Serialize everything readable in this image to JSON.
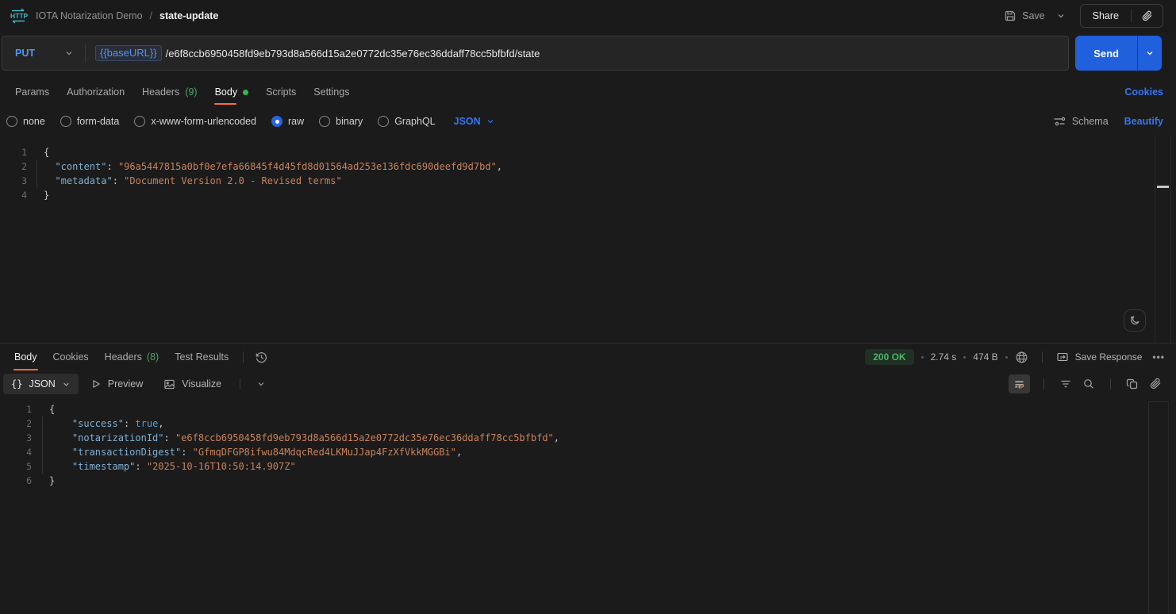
{
  "header": {
    "collection_name": "IOTA Notarization Demo",
    "separator": "/",
    "request_name": "state-update",
    "save_label": "Save",
    "share_label": "Share"
  },
  "request_bar": {
    "method": "PUT",
    "base_url_variable": "{{baseURL}}",
    "path": "/e6f8ccb6950458fd9eb793d8a566d15a2e0772dc35e76ec36ddaff78cc5bfbfd/state",
    "send_label": "Send"
  },
  "request_tabs": {
    "items": [
      {
        "label": "Params"
      },
      {
        "label": "Authorization"
      },
      {
        "label": "Headers",
        "count": "(9)"
      },
      {
        "label": "Body"
      },
      {
        "label": "Scripts"
      },
      {
        "label": "Settings"
      }
    ],
    "active_tab": "Body",
    "cookies_link": "Cookies"
  },
  "body_type": {
    "options": [
      "none",
      "form-data",
      "x-www-form-urlencoded",
      "raw",
      "binary",
      "GraphQL"
    ],
    "selected": "raw",
    "language": "JSON",
    "schema_label": "Schema",
    "beautify_label": "Beautify"
  },
  "request_body": {
    "raw_text": "{\n  \"content\": \"96a5447815a0bf0e7efa66845f4d45fd8d01564ad253e136fdc690deefd9d7bd\",\n  \"metadata\": \"Document Version 2.0 - Revised terms\"\n}",
    "lines": [
      [
        [
          "p",
          "{"
        ]
      ],
      [
        [
          "p",
          "  "
        ],
        [
          "k",
          "\"content\""
        ],
        [
          "p",
          ": "
        ],
        [
          "s",
          "\"96a5447815a0bf0e7efa66845f4d45fd8d01564ad253e136fdc690deefd9d7bd\""
        ],
        [
          "p",
          ","
        ]
      ],
      [
        [
          "p",
          "  "
        ],
        [
          "k",
          "\"metadata\""
        ],
        [
          "p",
          ": "
        ],
        [
          "s",
          "\"Document Version 2.0 - Revised terms\""
        ]
      ],
      [
        [
          "p",
          "}"
        ]
      ]
    ]
  },
  "response": {
    "tabs": [
      {
        "label": "Body"
      },
      {
        "label": "Cookies"
      },
      {
        "label": "Headers",
        "count": "(8)"
      },
      {
        "label": "Test Results"
      }
    ],
    "active_tab": "Body",
    "status": "200 OK",
    "time": "2.74 s",
    "size": "474 B",
    "save_response_label": "Save Response",
    "more_menu": "•••",
    "format_braces": "{}",
    "format_selector": "JSON",
    "preview_label": "Preview",
    "visualize_label": "Visualize",
    "raw_text": "{\n    \"success\": true,\n    \"notarizationId\": \"e6f8ccb6950458fd9eb793d8a566d15a2e0772dc35e76ec36ddaff78cc5bfbfd\",\n    \"transactionDigest\": \"GfmqDFGP8ifwu84MdqcRed4LKMuJJap4FzXfVkkMGGBi\",\n    \"timestamp\": \"2025-10-16T10:50:14.907Z\"\n}",
    "body_lines": [
      [
        [
          "p",
          "{"
        ]
      ],
      [
        [
          "p",
          "    "
        ],
        [
          "k",
          "\"success\""
        ],
        [
          "p",
          ": "
        ],
        [
          "b",
          "true"
        ],
        [
          "p",
          ","
        ]
      ],
      [
        [
          "p",
          "    "
        ],
        [
          "k",
          "\"notarizationId\""
        ],
        [
          "p",
          ": "
        ],
        [
          "s",
          "\"e6f8ccb6950458fd9eb793d8a566d15a2e0772dc35e76ec36ddaff78cc5bfbfd\""
        ],
        [
          "p",
          ","
        ]
      ],
      [
        [
          "p",
          "    "
        ],
        [
          "k",
          "\"transactionDigest\""
        ],
        [
          "p",
          ": "
        ],
        [
          "s",
          "\"GfmqDFGP8ifwu84MdqcRed4LKMuJJap4FzXfVkkMGGBi\""
        ],
        [
          "p",
          ","
        ]
      ],
      [
        [
          "p",
          "    "
        ],
        [
          "k",
          "\"timestamp\""
        ],
        [
          "p",
          ": "
        ],
        [
          "s",
          "\"2025-10-16T10:50:14.907Z\""
        ]
      ],
      [
        [
          "p",
          "}"
        ]
      ]
    ]
  },
  "colors": {
    "accent_orange": "#ff6c37",
    "link_blue": "#3576f0",
    "method_blue": "#4f97f6",
    "send_blue": "#2160dd",
    "success_green": "#49b665",
    "count_green": "#47a862",
    "syntax_key": "#7fb0d4",
    "syntax_string": "#c9825c",
    "syntax_boolean": "#4e9fe0",
    "http_logo_teal": "#3fb9c9"
  }
}
